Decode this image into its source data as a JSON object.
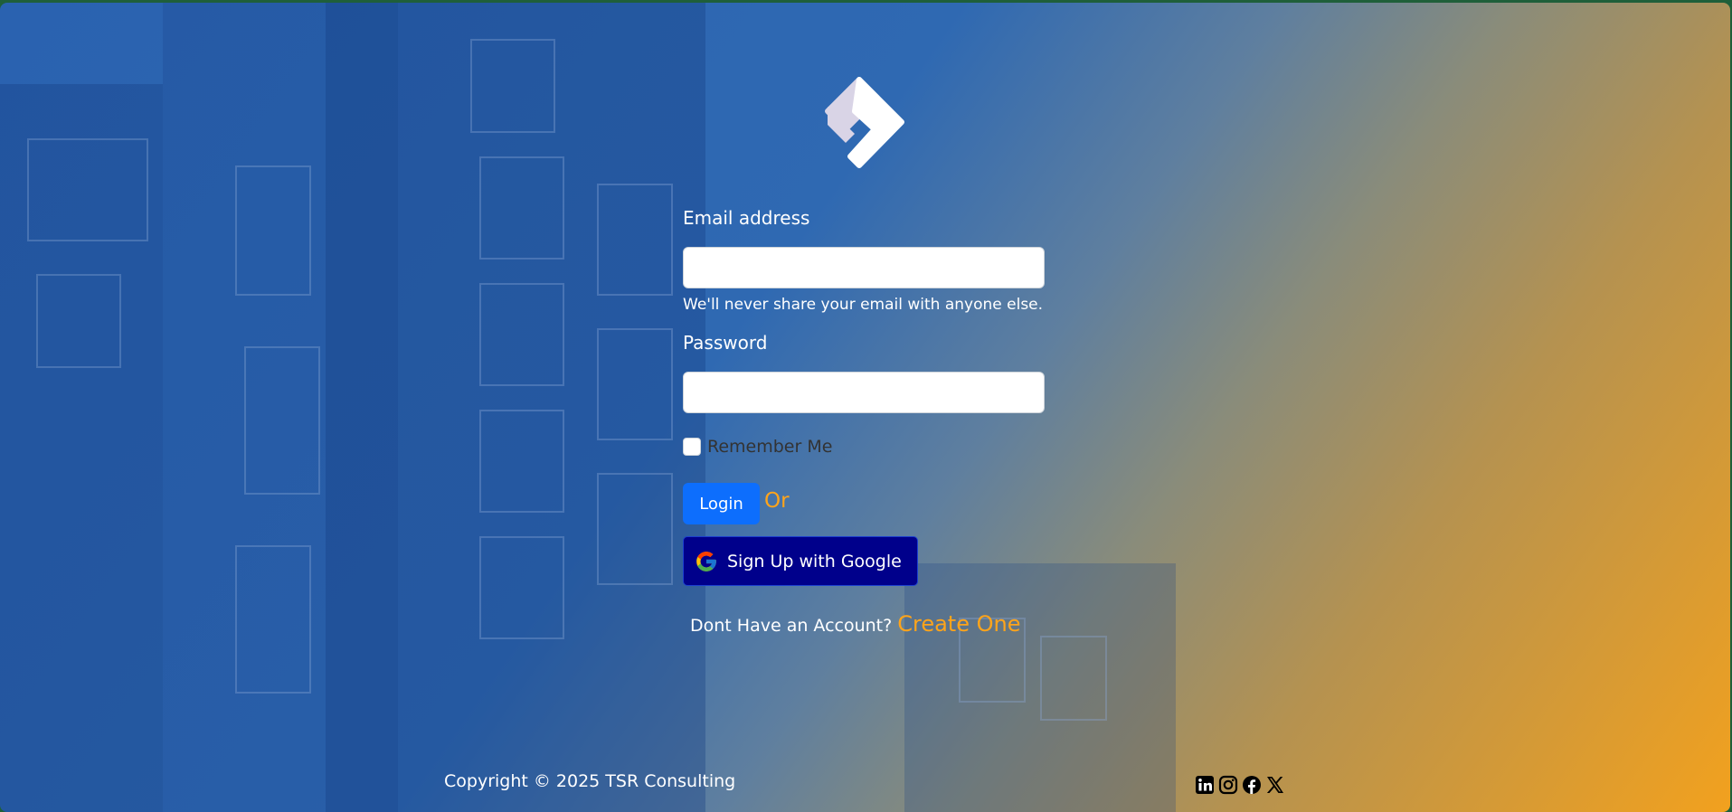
{
  "form": {
    "email_label": "Email address",
    "email_value": "",
    "email_help": "We'll never share your email with anyone else.",
    "password_label": "Password",
    "password_value": "",
    "remember_label": "Remember Me",
    "remember_checked": false,
    "login_label": "Login",
    "or_text": "Or",
    "google_label": "Sign Up with Google",
    "account_question": "Dont Have an Account?",
    "create_label": "Create One"
  },
  "footer": {
    "copyright": "Copyright © 2025 TSR Consulting",
    "social_icons": [
      "linkedin-icon",
      "instagram-icon",
      "facebook-icon",
      "x-icon"
    ]
  },
  "colors": {
    "accent_orange": "#ffa41a",
    "login_blue": "#0d6efd",
    "google_button": "#00008b",
    "gradient_start": "#2a62b0",
    "gradient_end": "#f2a11e"
  }
}
